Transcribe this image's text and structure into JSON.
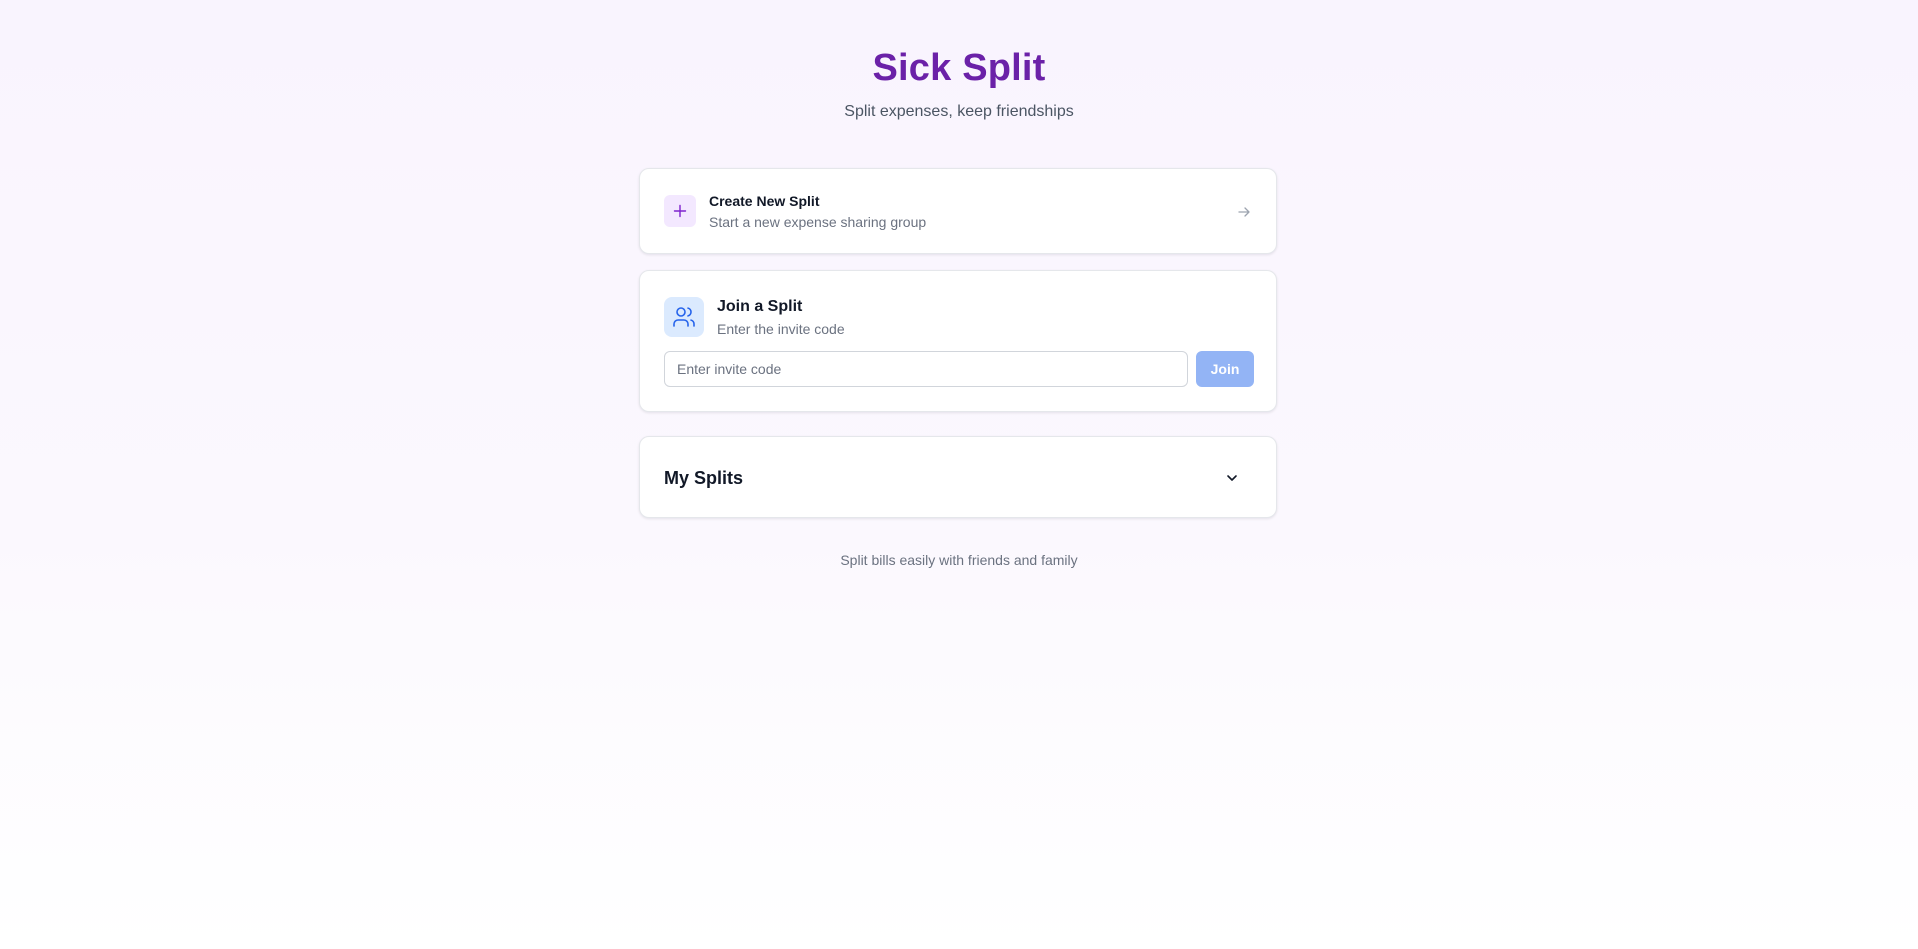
{
  "header": {
    "title": "Sick Split",
    "subtitle": "Split expenses, keep friendships"
  },
  "create_split": {
    "title": "Create New Split",
    "description": "Start a new expense sharing group",
    "icon": "plus-icon",
    "action_icon": "arrow-right-icon"
  },
  "join_split": {
    "title": "Join a Split",
    "description": "Enter the invite code",
    "icon": "users-icon",
    "input": {
      "value": "",
      "placeholder": "Enter invite code"
    },
    "button_label": "Join"
  },
  "my_splits": {
    "title": "My Splits",
    "toggle_icon": "chevron-down-icon"
  },
  "footer": {
    "text": "Split bills easily with friends and family"
  },
  "colors": {
    "brand": "#6b21a8",
    "create_icon_bg": "#f3e8ff",
    "join_icon_bg": "#dbeafe",
    "join_button_bg": "#93b4f5",
    "users_icon": "#2563eb"
  }
}
